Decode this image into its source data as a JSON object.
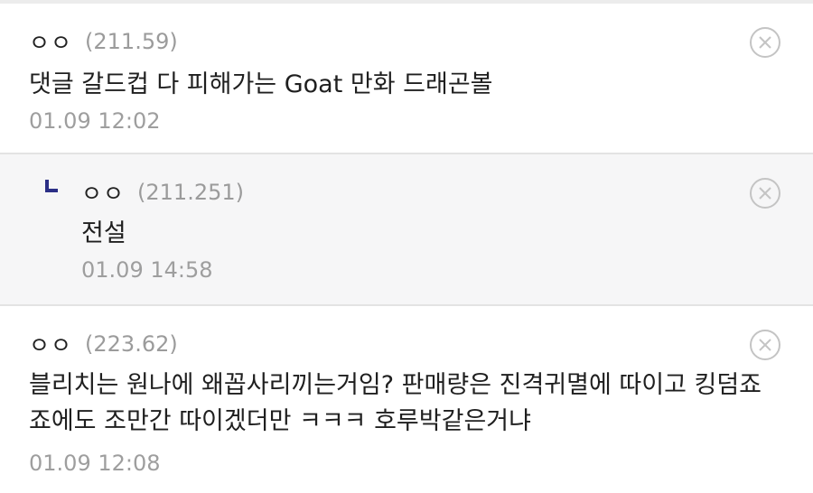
{
  "comments": [
    {
      "nickname": "ㅇㅇ",
      "ip": "(211.59)",
      "text": "댓글 갈드컵 다 피해가는 Goat 만화 드래곤볼",
      "date": "01.09 12:02"
    },
    {
      "nickname": "ㅇㅇ",
      "ip": "(211.251)",
      "text": "전설",
      "date": "01.09 14:58",
      "is_reply": true
    },
    {
      "nickname": "ㅇㅇ",
      "ip": "(223.62)",
      "text_lines": [
        "블리치는 원나에 왜꼽사리끼는거임? 판매량은 진격귀멸에 따이고 킹덤죠",
        "죠에도 조만간 따이겠더만 ㅋㅋㅋ 호루박같은거냐"
      ],
      "date": "01.09 12:08"
    }
  ],
  "icons": {
    "delete": "close-circle-icon",
    "reply": "reply-arrow-icon"
  },
  "colors": {
    "reply_icon": "#2b2f86",
    "muted_text": "#9b9b9b",
    "reply_background": "#f6f6f7"
  }
}
